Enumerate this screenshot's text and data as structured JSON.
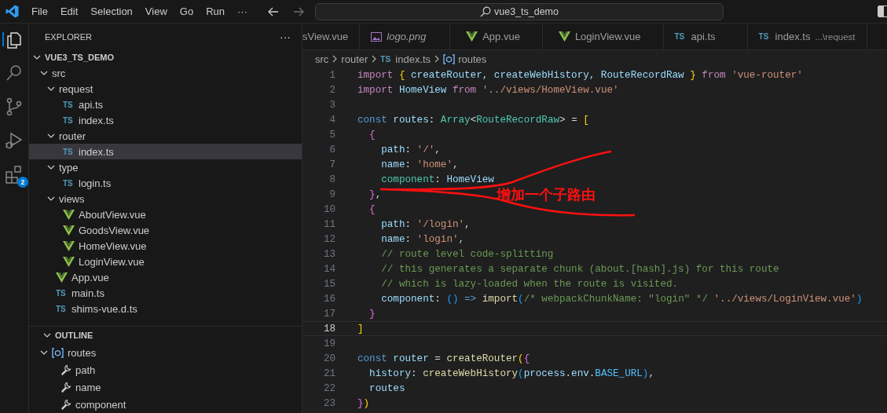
{
  "title_bar": {
    "menus": [
      "File",
      "Edit",
      "Selection",
      "View",
      "Go",
      "Run",
      "···"
    ],
    "search": {
      "value": "vue3_ts_demo"
    }
  },
  "activity_bar": [
    {
      "kind": "explorer",
      "selected": true
    },
    {
      "kind": "search",
      "selected": false
    },
    {
      "kind": "source-control",
      "selected": false
    },
    {
      "kind": "debug",
      "selected": false
    },
    {
      "kind": "extensions",
      "selected": false,
      "badge": "2"
    }
  ],
  "explorer": {
    "title": "EXPLORER",
    "more": "···",
    "tree": {
      "label": "VUE3_TS_DEMO",
      "kind": "folder",
      "expanded": true,
      "selected": false,
      "children": [
        {
          "label": "src",
          "kind": "folder",
          "expanded": true,
          "selected": false,
          "children": [
            {
              "label": "request",
              "kind": "folder",
              "expanded": true,
              "selected": false,
              "children": [
                {
                  "label": "api.ts",
                  "kind": "ts",
                  "icon": "TS",
                  "selected": false
                },
                {
                  "label": "index.ts",
                  "kind": "ts",
                  "icon": "TS",
                  "selected": false
                }
              ]
            },
            {
              "label": "router",
              "kind": "folder",
              "expanded": true,
              "selected": false,
              "children": [
                {
                  "label": "index.ts",
                  "kind": "ts",
                  "icon": "TS",
                  "selected": true
                }
              ]
            },
            {
              "label": "type",
              "kind": "folder",
              "expanded": true,
              "selected": false,
              "children": [
                {
                  "label": "login.ts",
                  "kind": "ts",
                  "icon": "TS",
                  "selected": false
                }
              ]
            },
            {
              "label": "views",
              "kind": "folder",
              "expanded": true,
              "selected": false,
              "children": [
                {
                  "label": "AboutView.vue",
                  "kind": "vue",
                  "selected": false
                },
                {
                  "label": "GoodsView.vue",
                  "kind": "vue",
                  "selected": false
                },
                {
                  "label": "HomeView.vue",
                  "kind": "vue",
                  "selected": false
                },
                {
                  "label": "LoginView.vue",
                  "kind": "vue",
                  "selected": false
                }
              ]
            },
            {
              "label": "App.vue",
              "kind": "vue",
              "selected": false
            },
            {
              "label": "main.ts",
              "kind": "ts",
              "icon": "TS",
              "selected": false
            },
            {
              "label": "shims-vue.d.ts",
              "kind": "ts",
              "icon": "TS",
              "selected": false
            }
          ]
        }
      ]
    }
  },
  "outline": {
    "title": "OUTLINE",
    "expanded": true,
    "items": [
      {
        "label": "routes",
        "kind": "variable",
        "expanded": true,
        "children": [
          {
            "label": "path",
            "kind": "property"
          },
          {
            "label": "name",
            "kind": "property"
          },
          {
            "label": "component",
            "kind": "property"
          }
        ]
      }
    ]
  },
  "tabs": [
    {
      "label": "sView.vue",
      "kind": "none",
      "selected": false
    },
    {
      "label": "logo.png",
      "kind": "image",
      "preview": true,
      "selected": false
    },
    {
      "label": "App.vue",
      "kind": "vue",
      "selected": false
    },
    {
      "label": "LoginView.vue",
      "kind": "vue",
      "selected": false
    },
    {
      "label": "api.ts",
      "kind": "ts",
      "icon": "TS",
      "selected": false
    },
    {
      "label": "index.ts",
      "kind": "ts",
      "icon": "TS",
      "description": "...\\request",
      "selected": false
    }
  ],
  "breadcrumb": [
    {
      "label": "src",
      "kind": "folder"
    },
    {
      "label": "router",
      "kind": "folder"
    },
    {
      "label": "index.ts",
      "kind": "ts",
      "icon": "TS"
    },
    {
      "label": "routes",
      "kind": "variable"
    }
  ],
  "code": [
    {
      "number": "1",
      "tokens": [
        {
          "text": "import ",
          "kind": "keyword"
        },
        {
          "text": "{",
          "kind": "bracket1"
        },
        {
          "text": " createRouter, createWebHistory, RouteRecordRaw ",
          "kind": "variable"
        },
        {
          "text": "}",
          "kind": "bracket1"
        },
        {
          "text": " from ",
          "kind": "keyword"
        },
        {
          "text": "'vue-router'",
          "kind": "string"
        }
      ]
    },
    {
      "number": "2",
      "tokens": [
        {
          "text": "import ",
          "kind": "keyword"
        },
        {
          "text": "HomeView",
          "kind": "variable"
        },
        {
          "text": " from ",
          "kind": "keyword"
        },
        {
          "text": "'../views/HomeView.vue'",
          "kind": "string"
        }
      ]
    },
    {
      "number": "3"
    },
    {
      "number": "4",
      "tokens": [
        {
          "text": "const ",
          "kind": "storage"
        },
        {
          "text": "routes",
          "kind": "variable"
        },
        {
          "text": ": ",
          "kind": "punct"
        },
        {
          "text": "Array",
          "kind": "type"
        },
        {
          "text": "<",
          "kind": "punct"
        },
        {
          "text": "RouteRecordRaw",
          "kind": "type"
        },
        {
          "text": "> = ",
          "kind": "punct"
        },
        {
          "text": "[",
          "kind": "bracket1"
        }
      ]
    },
    {
      "number": "5",
      "tokens": [
        {
          "text": "  {",
          "kind": "bracket2"
        }
      ]
    },
    {
      "number": "6",
      "tokens": [
        {
          "text": "    path",
          "kind": "variable"
        },
        {
          "text": ": ",
          "kind": "punct"
        },
        {
          "text": "'/'",
          "kind": "string"
        },
        {
          "text": ",",
          "kind": "punct"
        }
      ]
    },
    {
      "number": "7",
      "tokens": [
        {
          "text": "    name",
          "kind": "variable"
        },
        {
          "text": ": ",
          "kind": "punct"
        },
        {
          "text": "'home'",
          "kind": "string"
        },
        {
          "text": ",",
          "kind": "punct"
        }
      ]
    },
    {
      "number": "8",
      "tokens": [
        {
          "text": "    component",
          "kind": "type"
        },
        {
          "text": ": ",
          "kind": "punct"
        },
        {
          "text": "HomeView",
          "kind": "variable"
        }
      ]
    },
    {
      "number": "9",
      "tokens": [
        {
          "text": "  }",
          "kind": "bracket2"
        },
        {
          "text": ",",
          "kind": "punct"
        }
      ]
    },
    {
      "number": "10",
      "tokens": [
        {
          "text": "  {",
          "kind": "bracket2"
        }
      ]
    },
    {
      "number": "11",
      "tokens": [
        {
          "text": "    path",
          "kind": "variable"
        },
        {
          "text": ": ",
          "kind": "punct"
        },
        {
          "text": "'/login'",
          "kind": "string"
        },
        {
          "text": ",",
          "kind": "punct"
        }
      ]
    },
    {
      "number": "12",
      "tokens": [
        {
          "text": "    name",
          "kind": "variable"
        },
        {
          "text": ": ",
          "kind": "punct"
        },
        {
          "text": "'login'",
          "kind": "string"
        },
        {
          "text": ",",
          "kind": "punct"
        }
      ]
    },
    {
      "number": "13",
      "tokens": [
        {
          "text": "    // route level code-splitting",
          "kind": "comment"
        }
      ]
    },
    {
      "number": "14",
      "tokens": [
        {
          "text": "    // this generates a separate chunk (about.[hash].js) for this route",
          "kind": "comment"
        }
      ]
    },
    {
      "number": "15",
      "tokens": [
        {
          "text": "    // which is lazy-loaded when the route is visited.",
          "kind": "comment"
        }
      ]
    },
    {
      "number": "16",
      "tokens": [
        {
          "text": "    component",
          "kind": "variable"
        },
        {
          "text": ": ",
          "kind": "punct"
        },
        {
          "text": "()",
          "kind": "bracket3"
        },
        {
          "text": " => ",
          "kind": "storage"
        },
        {
          "text": "import",
          "kind": "function"
        },
        {
          "text": "(",
          "kind": "bracket3"
        },
        {
          "text": "/* webpackChunkName: \"login\" */",
          "kind": "comment"
        },
        {
          "text": " '../views/LoginView.vue'",
          "kind": "string"
        },
        {
          "text": ")",
          "kind": "bracket3"
        }
      ]
    },
    {
      "number": "17",
      "tokens": [
        {
          "text": "  }",
          "kind": "bracket2"
        }
      ]
    },
    {
      "number": "18",
      "current": true,
      "tokens": [
        {
          "text": "]",
          "kind": "bracket1"
        }
      ]
    },
    {
      "number": "19"
    },
    {
      "number": "20",
      "tokens": [
        {
          "text": "const ",
          "kind": "storage"
        },
        {
          "text": "router",
          "kind": "variable"
        },
        {
          "text": " = ",
          "kind": "punct"
        },
        {
          "text": "createRouter",
          "kind": "function"
        },
        {
          "text": "(",
          "kind": "bracket1"
        },
        {
          "text": "{",
          "kind": "bracket2"
        }
      ]
    },
    {
      "number": "21",
      "tokens": [
        {
          "text": "  history",
          "kind": "variable"
        },
        {
          "text": ": ",
          "kind": "punct"
        },
        {
          "text": "createWebHistory",
          "kind": "function"
        },
        {
          "text": "(",
          "kind": "bracket3"
        },
        {
          "text": "process",
          "kind": "variable"
        },
        {
          "text": ".",
          "kind": "punct"
        },
        {
          "text": "env",
          "kind": "variable"
        },
        {
          "text": ".",
          "kind": "punct"
        },
        {
          "text": "BASE_URL",
          "kind": "constant"
        },
        {
          "text": ")",
          "kind": "bracket3"
        },
        {
          "text": ",",
          "kind": "punct"
        }
      ]
    },
    {
      "number": "22",
      "tokens": [
        {
          "text": "  routes",
          "kind": "variable"
        }
      ]
    },
    {
      "number": "23",
      "tokens": [
        {
          "text": "}",
          "kind": "bracket2"
        },
        {
          "text": ")",
          "kind": "bracket1"
        }
      ]
    }
  ],
  "annotation": {
    "text": "增加一个子路由"
  }
}
